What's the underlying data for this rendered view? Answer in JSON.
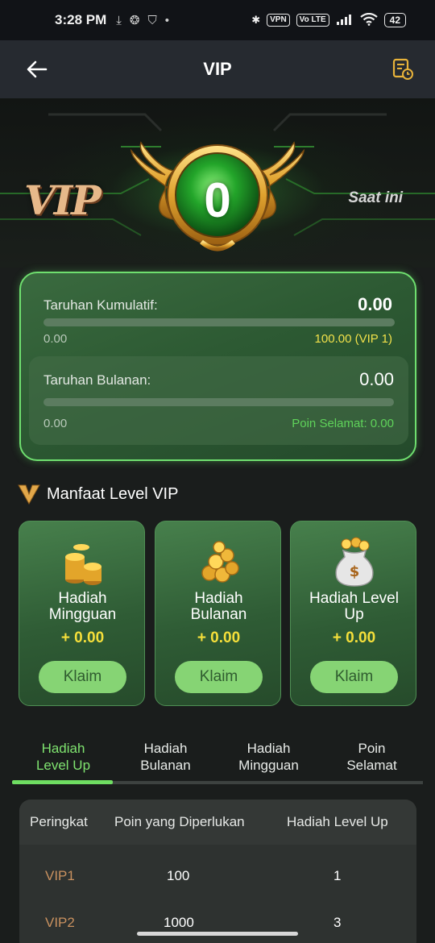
{
  "status_bar": {
    "time": "3:28 PM",
    "vpn_label": "VPN",
    "volte_label": "Vo LTE",
    "battery_level": "42"
  },
  "header": {
    "title": "VIP",
    "back_icon": "arrow-left-icon",
    "history_icon": "history-icon"
  },
  "hero": {
    "vip_logo_text": "VIP",
    "current_level": "0",
    "current_label": "Saat ini"
  },
  "wager": {
    "cumulative_label": "Taruhan Kumulatif:",
    "cumulative_value": "0.00",
    "cumulative_min": "0.00",
    "cumulative_target": "100.00 (VIP 1)",
    "cumulative_progress": 0,
    "monthly_label": "Taruhan Bulanan:",
    "monthly_value": "0.00",
    "monthly_min": "0.00",
    "monthly_points": "Poin Selamat: 0.00",
    "monthly_progress": 0
  },
  "benefits": {
    "title": "Manfaat Level VIP",
    "cards": [
      {
        "title_line1": "Hadiah",
        "title_line2": "Mingguan",
        "amount": "+ 0.00",
        "button": "Klaim",
        "icon": "coin-stack-icon"
      },
      {
        "title_line1": "Hadiah",
        "title_line2": "Bulanan",
        "amount": "+ 0.00",
        "button": "Klaim",
        "icon": "coin-pile-icon"
      },
      {
        "title_line1": "Hadiah Level",
        "title_line2": "Up",
        "amount": "+ 0.00",
        "button": "Klaim",
        "icon": "money-bag-icon"
      }
    ]
  },
  "tabs": [
    {
      "line1": "Hadiah",
      "line2": "Level Up",
      "active": true
    },
    {
      "line1": "Hadiah",
      "line2": "Bulanan",
      "active": false
    },
    {
      "line1": "Hadiah",
      "line2": "Mingguan",
      "active": false
    },
    {
      "line1": "Poin",
      "line2": "Selamat",
      "active": false
    }
  ],
  "table": {
    "headers": [
      "Peringkat",
      "Poin yang Diperlukan",
      "Hadiah Level Up"
    ],
    "rows": [
      [
        "VIP1",
        "100",
        "1"
      ],
      [
        "VIP2",
        "1000",
        "3"
      ]
    ]
  },
  "colors": {
    "accent_green": "#7fe36f",
    "amount_yellow": "#f5df3a",
    "target_yellow": "#f0e04a",
    "points_green": "#5fd35a",
    "rank_orange": "#c9915f"
  }
}
